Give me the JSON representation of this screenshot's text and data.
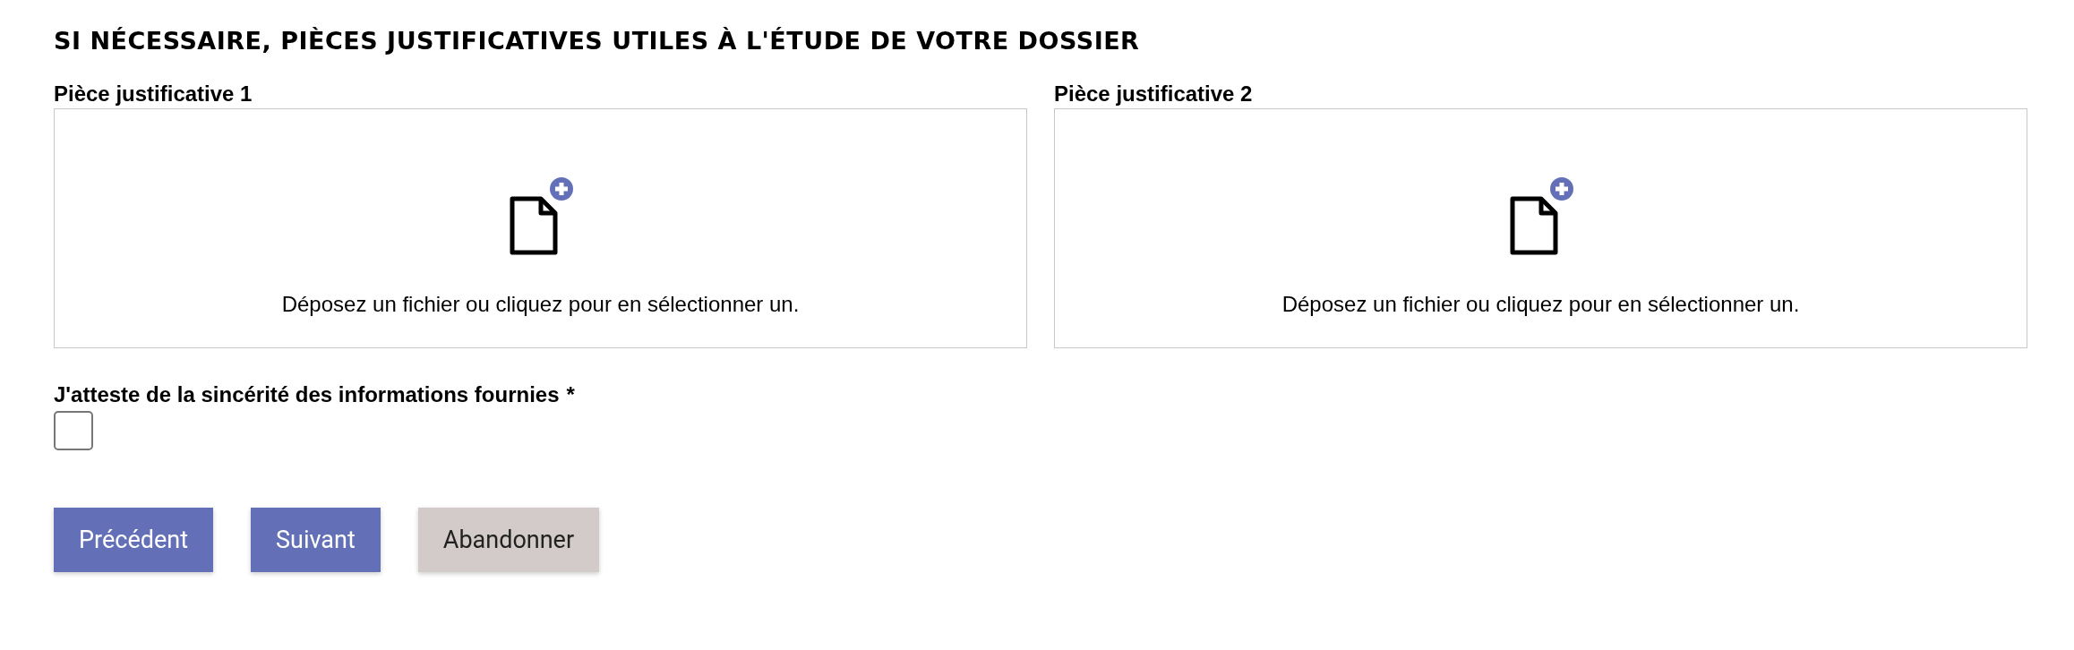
{
  "section_title": "SI NÉCESSAIRE, PIÈCES JUSTIFICATIVES UTILES À L'ÉTUDE DE VOTRE DOSSIER",
  "uploads": [
    {
      "label": "Pièce justificative 1",
      "hint": "Déposez un fichier ou cliquez pour en sélectionner un."
    },
    {
      "label": "Pièce justificative 2",
      "hint": "Déposez un fichier ou cliquez pour en sélectionner un."
    }
  ],
  "attestation": {
    "label": "J'atteste de la sincérité des informations fournies",
    "required_mark": "*",
    "checked": false
  },
  "buttons": [
    {
      "label": "Précédent",
      "kind": "primary"
    },
    {
      "label": "Suivant",
      "kind": "primary"
    },
    {
      "label": "Abandonner",
      "kind": "secondary"
    }
  ]
}
